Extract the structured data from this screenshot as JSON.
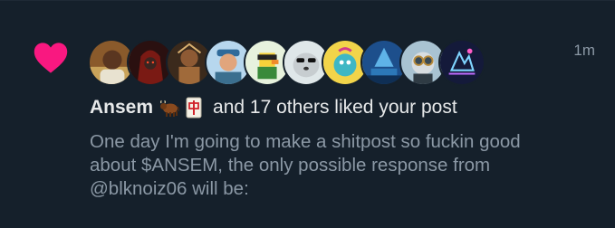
{
  "notification": {
    "type": "like",
    "icon": "heart-icon",
    "timestamp": "1m",
    "actor_name": "Ansem",
    "actor_emojis": [
      "ox-emoji",
      "mahjong-red-dragon-emoji"
    ],
    "summary_text": "and 17 others liked your post",
    "post_text": "One day I'm going to make a shitpost so fuckin good\nabout $ANSEM, the only possible response from\n@blknoiz06 will be:",
    "avatar_count": 10
  },
  "colors": {
    "background": "#15202b",
    "heart": "#f91880",
    "primary_text": "#e7e9ea",
    "secondary_text": "#8b98a5"
  }
}
